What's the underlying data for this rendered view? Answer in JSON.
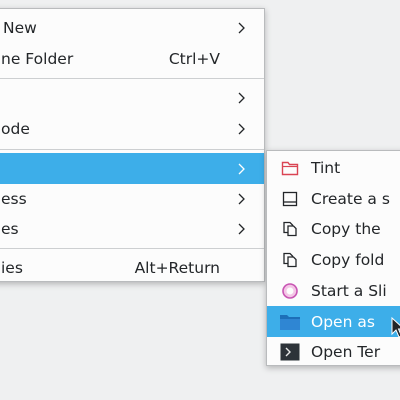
{
  "main_menu": {
    "items": [
      {
        "label": "New",
        "submenu": true
      },
      {
        "label": "ne Folder",
        "shortcut": "Ctrl+V"
      },
      {
        "label": "",
        "submenu": true
      },
      {
        "label": "ode",
        "submenu": true
      },
      {
        "label": "",
        "submenu": true,
        "active": true
      },
      {
        "label": "ess",
        "submenu": true
      },
      {
        "label": "es",
        "submenu": true
      },
      {
        "label": "ies",
        "shortcut": "Alt+Return"
      }
    ]
  },
  "sub_menu": {
    "items": [
      {
        "label": "Tint",
        "icon": "folder-outline-red-icon"
      },
      {
        "label": "Create a s",
        "icon": "window-icon"
      },
      {
        "label": "Copy the",
        "icon": "copy-icon"
      },
      {
        "label": "Copy fold",
        "icon": "copy-icon"
      },
      {
        "label": "Start a Sli",
        "icon": "circle-icon"
      },
      {
        "label": "Open as",
        "icon": "folder-blue-icon",
        "active": true
      },
      {
        "label": "Open Ter",
        "icon": "terminal-icon"
      }
    ]
  },
  "colors": {
    "highlight": "#3daee9",
    "menu_bg": "#fcfcfc",
    "desktop_bg": "#eff0f1",
    "text": "#232629"
  }
}
